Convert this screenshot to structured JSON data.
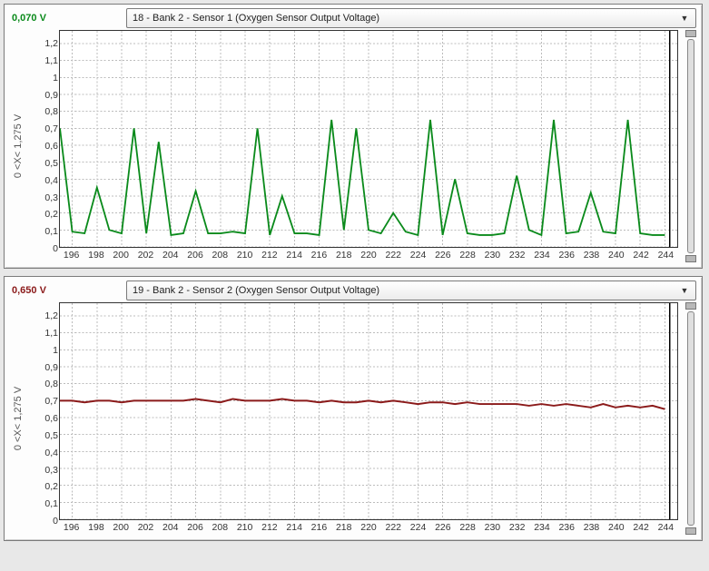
{
  "panels": [
    {
      "value_label": "0,070 V",
      "value_color": "#0a8a1b",
      "dropdown_text": "18 - Bank 2 - Sensor 1 (Oxygen Sensor Output Voltage)",
      "ylabel": "0 <X< 1,275 V"
    },
    {
      "value_label": "0,650 V",
      "value_color": "#8b1a1a",
      "dropdown_text": "19 - Bank 2 - Sensor 2 (Oxygen Sensor Output Voltage)",
      "ylabel": "0 <X< 1,275 V"
    }
  ],
  "y_ticks": [
    "0",
    "0,1",
    "0,2",
    "0,3",
    "0,4",
    "0,5",
    "0,6",
    "0,7",
    "0,8",
    "0,9",
    "1",
    "1,1",
    "1,2"
  ],
  "y_tick_values": [
    0,
    0.1,
    0.2,
    0.3,
    0.4,
    0.5,
    0.6,
    0.7,
    0.8,
    0.9,
    1.0,
    1.1,
    1.2
  ],
  "x_ticks": [
    196,
    198,
    200,
    202,
    204,
    206,
    208,
    210,
    212,
    214,
    216,
    218,
    220,
    222,
    224,
    226,
    228,
    230,
    232,
    234,
    236,
    238,
    240,
    242,
    244
  ],
  "axes": {
    "ymin": 0,
    "ymax": 1.275,
    "xmin": 195,
    "xmax": 245
  },
  "chart_data": [
    {
      "type": "line",
      "title": "18 - Bank 2 - Sensor 1 (Oxygen Sensor Output Voltage)",
      "xlabel": "",
      "ylabel": "0 <X< 1,275 V",
      "ylim": [
        0,
        1.275
      ],
      "x": [
        195,
        196,
        197,
        198,
        199,
        200,
        201,
        202,
        203,
        204,
        205,
        206,
        207,
        208,
        209,
        210,
        211,
        212,
        213,
        214,
        215,
        216,
        217,
        218,
        219,
        220,
        221,
        222,
        223,
        224,
        225,
        226,
        227,
        228,
        229,
        230,
        231,
        232,
        233,
        234,
        235,
        236,
        237,
        238,
        239,
        240,
        241,
        242,
        243,
        244
      ],
      "values": [
        0.7,
        0.09,
        0.08,
        0.35,
        0.1,
        0.08,
        0.7,
        0.08,
        0.62,
        0.07,
        0.08,
        0.33,
        0.08,
        0.08,
        0.09,
        0.08,
        0.7,
        0.07,
        0.3,
        0.08,
        0.08,
        0.07,
        0.75,
        0.1,
        0.7,
        0.1,
        0.08,
        0.2,
        0.09,
        0.07,
        0.75,
        0.07,
        0.4,
        0.08,
        0.07,
        0.07,
        0.08,
        0.42,
        0.1,
        0.07,
        0.75,
        0.08,
        0.09,
        0.32,
        0.09,
        0.08,
        0.75,
        0.08,
        0.07,
        0.07
      ],
      "color": "#0a8a1b",
      "current_value_label": "0,070 V"
    },
    {
      "type": "line",
      "title": "19 - Bank 2 - Sensor 2 (Oxygen Sensor Output Voltage)",
      "xlabel": "",
      "ylabel": "0 <X< 1,275 V",
      "ylim": [
        0,
        1.275
      ],
      "x": [
        195,
        196,
        197,
        198,
        199,
        200,
        201,
        202,
        203,
        204,
        205,
        206,
        207,
        208,
        209,
        210,
        211,
        212,
        213,
        214,
        215,
        216,
        217,
        218,
        219,
        220,
        221,
        222,
        223,
        224,
        225,
        226,
        227,
        228,
        229,
        230,
        231,
        232,
        233,
        234,
        235,
        236,
        237,
        238,
        239,
        240,
        241,
        242,
        243,
        244
      ],
      "values": [
        0.7,
        0.7,
        0.69,
        0.7,
        0.7,
        0.69,
        0.7,
        0.7,
        0.7,
        0.7,
        0.7,
        0.71,
        0.7,
        0.69,
        0.71,
        0.7,
        0.7,
        0.7,
        0.71,
        0.7,
        0.7,
        0.69,
        0.7,
        0.69,
        0.69,
        0.7,
        0.69,
        0.7,
        0.69,
        0.68,
        0.69,
        0.69,
        0.68,
        0.69,
        0.68,
        0.68,
        0.68,
        0.68,
        0.67,
        0.68,
        0.67,
        0.68,
        0.67,
        0.66,
        0.68,
        0.66,
        0.67,
        0.66,
        0.67,
        0.65
      ],
      "color": "#8b1a1a",
      "current_value_label": "0,650 V"
    }
  ]
}
